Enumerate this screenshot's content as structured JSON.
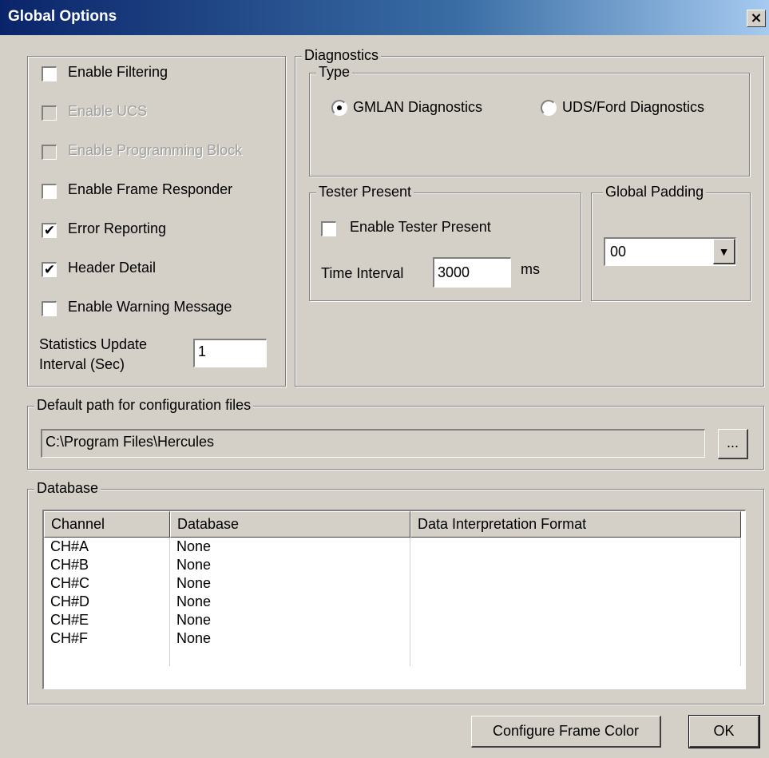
{
  "window": {
    "title": "Global Options",
    "close_glyph": "×"
  },
  "options": {
    "checkboxes": [
      {
        "label": "Enable Filtering",
        "checked": false,
        "enabled": true
      },
      {
        "label": "Enable UCS",
        "checked": false,
        "enabled": false
      },
      {
        "label": "Enable Programming Block",
        "checked": false,
        "enabled": false
      },
      {
        "label": "Enable Frame Responder",
        "checked": false,
        "enabled": true
      },
      {
        "label": "Error Reporting",
        "checked": true,
        "enabled": true
      },
      {
        "label": "Header Detail",
        "checked": true,
        "enabled": true
      },
      {
        "label": "Enable Warning Message",
        "checked": false,
        "enabled": true
      }
    ],
    "stats_label_line1": "Statistics Update",
    "stats_label_line2": "Interval  (Sec)",
    "stats_value": "1"
  },
  "diagnostics": {
    "label": "Diagnostics",
    "type_label": "Type",
    "radio_gmlan": "GMLAN Diagnostics",
    "radio_uds": "UDS/Ford Diagnostics",
    "selected": "GMLAN Diagnostics",
    "tester_label": "Tester Present",
    "tester_enable": "Enable Tester Present",
    "tester_checked": false,
    "time_interval_label": "Time Interval",
    "time_interval_value": "3000",
    "time_unit": "ms",
    "padding_label": "Global Padding",
    "padding_value": "00",
    "dropdown_glyph": "▼"
  },
  "path": {
    "label": "Default path for configuration files",
    "value": "C:\\Program Files\\Hercules",
    "browse": "..."
  },
  "database": {
    "label": "Database",
    "headers": [
      "Channel",
      "Database",
      "Data Interpretation Format"
    ],
    "rows": [
      [
        "CH#A",
        "None",
        ""
      ],
      [
        "CH#B",
        "None",
        ""
      ],
      [
        "CH#C",
        "None",
        ""
      ],
      [
        "CH#D",
        "None",
        ""
      ],
      [
        "CH#E",
        "None",
        ""
      ],
      [
        "CH#F",
        "None",
        ""
      ]
    ]
  },
  "buttons": {
    "configure": "Configure Frame Color",
    "ok": "OK"
  }
}
